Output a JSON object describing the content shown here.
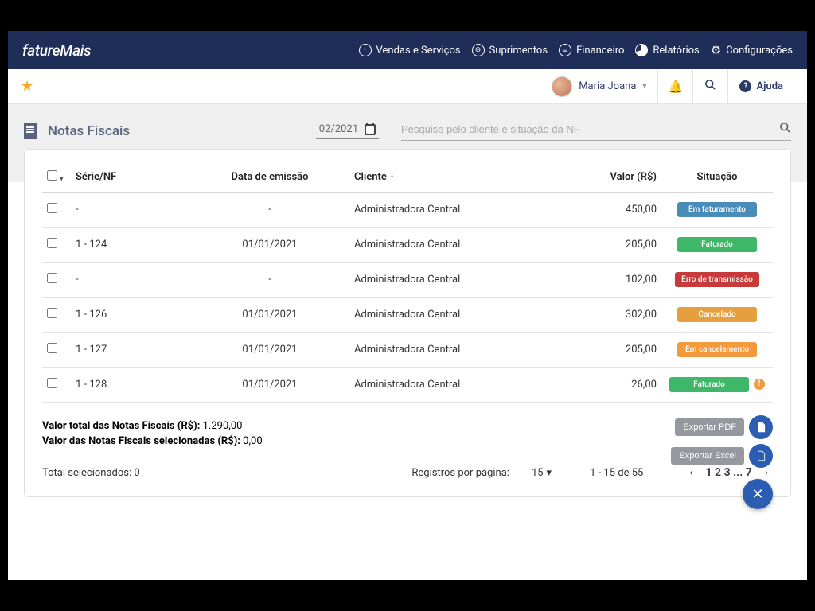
{
  "brand": {
    "name": "fatureMais"
  },
  "nav": {
    "items": [
      {
        "label": "Vendas e Serviços"
      },
      {
        "label": "Suprimentos"
      },
      {
        "label": "Financeiro"
      },
      {
        "label": "Relatórios"
      },
      {
        "label": "Configurações"
      }
    ]
  },
  "user": {
    "name": "Maria Joana"
  },
  "help": {
    "label": "Ajuda"
  },
  "page": {
    "title": "Notas Fiscais",
    "date_filter": "02/2021",
    "search_placeholder": "Pesquise pelo cliente e situação da NF"
  },
  "table": {
    "headers": {
      "serie": "Série/NF",
      "data": "Data de emissão",
      "cliente": "Cliente",
      "valor": "Valor (R$)",
      "situacao": "Situação"
    },
    "rows": [
      {
        "serie": "-",
        "data": "-",
        "cliente": "Administradora Central",
        "valor": "450,00",
        "status": "Em faturamento",
        "status_class": "b-blue"
      },
      {
        "serie": "1 - 124",
        "data": "01/01/2021",
        "cliente": "Administradora Central",
        "valor": "205,00",
        "status": "Faturado",
        "status_class": "b-green"
      },
      {
        "serie": "-",
        "data": "-",
        "cliente": "Administradora Central",
        "valor": "102,00",
        "status": "Erro de transmissão",
        "status_class": "b-red"
      },
      {
        "serie": "1 - 126",
        "data": "01/01/2021",
        "cliente": "Administradora Central",
        "valor": "302,00",
        "status": "Cancelado",
        "status_class": "b-orange"
      },
      {
        "serie": "1 - 127",
        "data": "01/01/2021",
        "cliente": "Administradora Central",
        "valor": "205,00",
        "status": "Em cancelamento",
        "status_class": "b-orange2"
      },
      {
        "serie": "1 - 128",
        "data": "01/01/2021",
        "cliente": "Administradora Central",
        "valor": "26,00",
        "status": "Faturado",
        "status_class": "b-green",
        "warn": true
      }
    ]
  },
  "totals": {
    "total_label": "Valor total das Notas Fiscais (R$): ",
    "total_value": "1.290,00",
    "selected_label": "Valor das Notas Fiscais selecionadas (R$): ",
    "selected_value": "0,00"
  },
  "export": {
    "pdf": "Exportar PDF",
    "excel": "Exportar Excel"
  },
  "pager": {
    "selected_count_label": "Total selecionados: ",
    "selected_count": "0",
    "rpp_label": "Registros por página:",
    "rpp_value": "15",
    "range": "1 - 15 de 55",
    "pages": "1 2 3 ... 7"
  }
}
